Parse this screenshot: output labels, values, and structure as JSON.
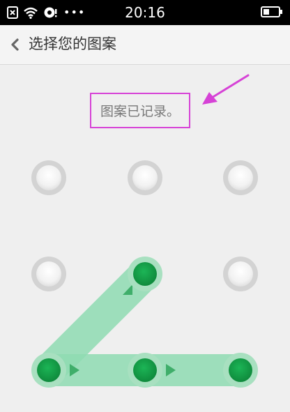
{
  "status_bar": {
    "time": "20:16",
    "overflow_indicator": "•••",
    "icons": [
      "sim-error-icon",
      "wifi-icon",
      "sync-alert-icon",
      "battery-icon"
    ]
  },
  "nav": {
    "back_icon": "chevron-left-icon",
    "title": "选择您的图案"
  },
  "message": {
    "text": "图案已记录。",
    "highlight_color": "#d642d6"
  },
  "pattern": {
    "grid_rows": 3,
    "grid_cols": 3,
    "selected_nodes": [
      7,
      8,
      9,
      5
    ],
    "path_color": "#7ed4a6",
    "active_color": "#15a04a",
    "inactive_color": "#f3f3f3"
  }
}
